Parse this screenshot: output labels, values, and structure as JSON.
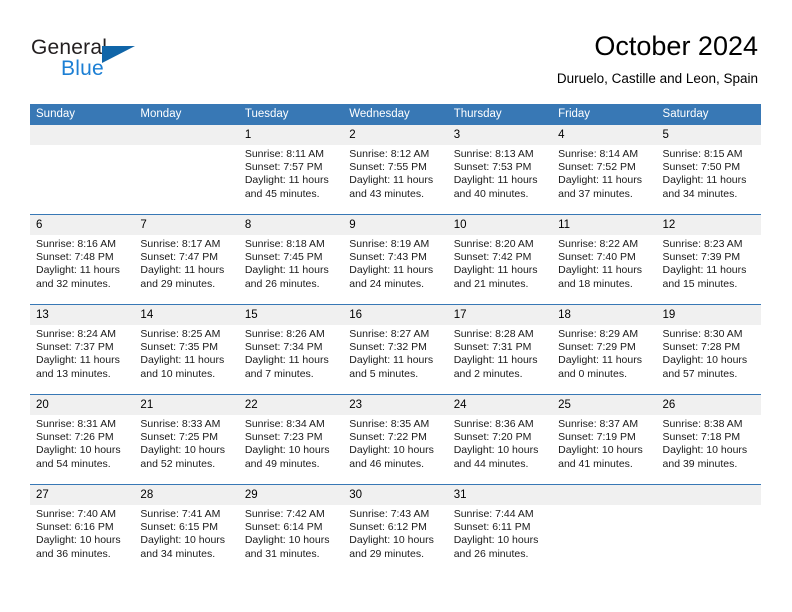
{
  "brand": {
    "name_part1": "General",
    "name_part2": "Blue",
    "triangle_icon": "triangle-icon",
    "accent_color": "#1065a8",
    "text_color": "#231f20"
  },
  "header": {
    "title": "October 2024",
    "subtitle": "Duruelo, Castille and Leon, Spain"
  },
  "calendar": {
    "header_bg": "#3878b5",
    "daynum_bg": "#f0f0f0",
    "weekday_headers": [
      "Sunday",
      "Monday",
      "Tuesday",
      "Wednesday",
      "Thursday",
      "Friday",
      "Saturday"
    ],
    "weeks": [
      [
        {
          "day": "",
          "sunrise": "",
          "sunset": "",
          "daylight_line1": "",
          "daylight_line2": "",
          "empty": true
        },
        {
          "day": "",
          "sunrise": "",
          "sunset": "",
          "daylight_line1": "",
          "daylight_line2": "",
          "empty": true
        },
        {
          "day": "1",
          "sunrise": "Sunrise: 8:11 AM",
          "sunset": "Sunset: 7:57 PM",
          "daylight_line1": "Daylight: 11 hours",
          "daylight_line2": "and 45 minutes."
        },
        {
          "day": "2",
          "sunrise": "Sunrise: 8:12 AM",
          "sunset": "Sunset: 7:55 PM",
          "daylight_line1": "Daylight: 11 hours",
          "daylight_line2": "and 43 minutes."
        },
        {
          "day": "3",
          "sunrise": "Sunrise: 8:13 AM",
          "sunset": "Sunset: 7:53 PM",
          "daylight_line1": "Daylight: 11 hours",
          "daylight_line2": "and 40 minutes."
        },
        {
          "day": "4",
          "sunrise": "Sunrise: 8:14 AM",
          "sunset": "Sunset: 7:52 PM",
          "daylight_line1": "Daylight: 11 hours",
          "daylight_line2": "and 37 minutes."
        },
        {
          "day": "5",
          "sunrise": "Sunrise: 8:15 AM",
          "sunset": "Sunset: 7:50 PM",
          "daylight_line1": "Daylight: 11 hours",
          "daylight_line2": "and 34 minutes."
        }
      ],
      [
        {
          "day": "6",
          "sunrise": "Sunrise: 8:16 AM",
          "sunset": "Sunset: 7:48 PM",
          "daylight_line1": "Daylight: 11 hours",
          "daylight_line2": "and 32 minutes."
        },
        {
          "day": "7",
          "sunrise": "Sunrise: 8:17 AM",
          "sunset": "Sunset: 7:47 PM",
          "daylight_line1": "Daylight: 11 hours",
          "daylight_line2": "and 29 minutes."
        },
        {
          "day": "8",
          "sunrise": "Sunrise: 8:18 AM",
          "sunset": "Sunset: 7:45 PM",
          "daylight_line1": "Daylight: 11 hours",
          "daylight_line2": "and 26 minutes."
        },
        {
          "day": "9",
          "sunrise": "Sunrise: 8:19 AM",
          "sunset": "Sunset: 7:43 PM",
          "daylight_line1": "Daylight: 11 hours",
          "daylight_line2": "and 24 minutes."
        },
        {
          "day": "10",
          "sunrise": "Sunrise: 8:20 AM",
          "sunset": "Sunset: 7:42 PM",
          "daylight_line1": "Daylight: 11 hours",
          "daylight_line2": "and 21 minutes."
        },
        {
          "day": "11",
          "sunrise": "Sunrise: 8:22 AM",
          "sunset": "Sunset: 7:40 PM",
          "daylight_line1": "Daylight: 11 hours",
          "daylight_line2": "and 18 minutes."
        },
        {
          "day": "12",
          "sunrise": "Sunrise: 8:23 AM",
          "sunset": "Sunset: 7:39 PM",
          "daylight_line1": "Daylight: 11 hours",
          "daylight_line2": "and 15 minutes."
        }
      ],
      [
        {
          "day": "13",
          "sunrise": "Sunrise: 8:24 AM",
          "sunset": "Sunset: 7:37 PM",
          "daylight_line1": "Daylight: 11 hours",
          "daylight_line2": "and 13 minutes."
        },
        {
          "day": "14",
          "sunrise": "Sunrise: 8:25 AM",
          "sunset": "Sunset: 7:35 PM",
          "daylight_line1": "Daylight: 11 hours",
          "daylight_line2": "and 10 minutes."
        },
        {
          "day": "15",
          "sunrise": "Sunrise: 8:26 AM",
          "sunset": "Sunset: 7:34 PM",
          "daylight_line1": "Daylight: 11 hours",
          "daylight_line2": "and 7 minutes."
        },
        {
          "day": "16",
          "sunrise": "Sunrise: 8:27 AM",
          "sunset": "Sunset: 7:32 PM",
          "daylight_line1": "Daylight: 11 hours",
          "daylight_line2": "and 5 minutes."
        },
        {
          "day": "17",
          "sunrise": "Sunrise: 8:28 AM",
          "sunset": "Sunset: 7:31 PM",
          "daylight_line1": "Daylight: 11 hours",
          "daylight_line2": "and 2 minutes."
        },
        {
          "day": "18",
          "sunrise": "Sunrise: 8:29 AM",
          "sunset": "Sunset: 7:29 PM",
          "daylight_line1": "Daylight: 11 hours",
          "daylight_line2": "and 0 minutes."
        },
        {
          "day": "19",
          "sunrise": "Sunrise: 8:30 AM",
          "sunset": "Sunset: 7:28 PM",
          "daylight_line1": "Daylight: 10 hours",
          "daylight_line2": "and 57 minutes."
        }
      ],
      [
        {
          "day": "20",
          "sunrise": "Sunrise: 8:31 AM",
          "sunset": "Sunset: 7:26 PM",
          "daylight_line1": "Daylight: 10 hours",
          "daylight_line2": "and 54 minutes."
        },
        {
          "day": "21",
          "sunrise": "Sunrise: 8:33 AM",
          "sunset": "Sunset: 7:25 PM",
          "daylight_line1": "Daylight: 10 hours",
          "daylight_line2": "and 52 minutes."
        },
        {
          "day": "22",
          "sunrise": "Sunrise: 8:34 AM",
          "sunset": "Sunset: 7:23 PM",
          "daylight_line1": "Daylight: 10 hours",
          "daylight_line2": "and 49 minutes."
        },
        {
          "day": "23",
          "sunrise": "Sunrise: 8:35 AM",
          "sunset": "Sunset: 7:22 PM",
          "daylight_line1": "Daylight: 10 hours",
          "daylight_line2": "and 46 minutes."
        },
        {
          "day": "24",
          "sunrise": "Sunrise: 8:36 AM",
          "sunset": "Sunset: 7:20 PM",
          "daylight_line1": "Daylight: 10 hours",
          "daylight_line2": "and 44 minutes."
        },
        {
          "day": "25",
          "sunrise": "Sunrise: 8:37 AM",
          "sunset": "Sunset: 7:19 PM",
          "daylight_line1": "Daylight: 10 hours",
          "daylight_line2": "and 41 minutes."
        },
        {
          "day": "26",
          "sunrise": "Sunrise: 8:38 AM",
          "sunset": "Sunset: 7:18 PM",
          "daylight_line1": "Daylight: 10 hours",
          "daylight_line2": "and 39 minutes."
        }
      ],
      [
        {
          "day": "27",
          "sunrise": "Sunrise: 7:40 AM",
          "sunset": "Sunset: 6:16 PM",
          "daylight_line1": "Daylight: 10 hours",
          "daylight_line2": "and 36 minutes."
        },
        {
          "day": "28",
          "sunrise": "Sunrise: 7:41 AM",
          "sunset": "Sunset: 6:15 PM",
          "daylight_line1": "Daylight: 10 hours",
          "daylight_line2": "and 34 minutes."
        },
        {
          "day": "29",
          "sunrise": "Sunrise: 7:42 AM",
          "sunset": "Sunset: 6:14 PM",
          "daylight_line1": "Daylight: 10 hours",
          "daylight_line2": "and 31 minutes."
        },
        {
          "day": "30",
          "sunrise": "Sunrise: 7:43 AM",
          "sunset": "Sunset: 6:12 PM",
          "daylight_line1": "Daylight: 10 hours",
          "daylight_line2": "and 29 minutes."
        },
        {
          "day": "31",
          "sunrise": "Sunrise: 7:44 AM",
          "sunset": "Sunset: 6:11 PM",
          "daylight_line1": "Daylight: 10 hours",
          "daylight_line2": "and 26 minutes."
        },
        {
          "day": "",
          "sunrise": "",
          "sunset": "",
          "daylight_line1": "",
          "daylight_line2": "",
          "empty": true
        },
        {
          "day": "",
          "sunrise": "",
          "sunset": "",
          "daylight_line1": "",
          "daylight_line2": "",
          "empty": true
        }
      ]
    ]
  }
}
